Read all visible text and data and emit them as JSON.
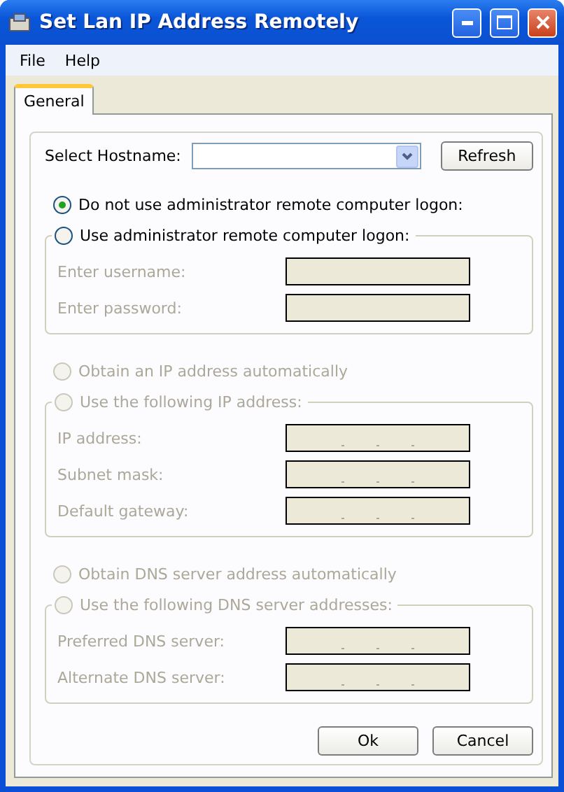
{
  "window": {
    "title": "Set Lan IP Address Remotely"
  },
  "menu": [
    {
      "label": "File"
    },
    {
      "label": "Help"
    }
  ],
  "tabs": [
    {
      "label": "General",
      "selected": true
    }
  ],
  "hostname": {
    "label": "Select Hostname:",
    "refresh": "Refresh"
  },
  "sections": [
    {
      "auto_option": {
        "label": "Do not use administrator remote computer logon:",
        "selected": true,
        "disabled": false
      },
      "manual_option": {
        "label": "Use administrator remote computer logon:",
        "selected": false,
        "disabled": false
      },
      "fields": [
        {
          "label": "Enter username:",
          "kind": "text",
          "disabled": true
        },
        {
          "label": "Enter password:",
          "kind": "text",
          "disabled": true
        }
      ]
    },
    {
      "auto_option": {
        "label": "Obtain an IP address automatically",
        "selected": false,
        "disabled": true
      },
      "manual_option": {
        "label": "Use the following IP address:",
        "selected": false,
        "disabled": true
      },
      "fields": [
        {
          "label": "IP address:",
          "kind": "ip",
          "disabled": true
        },
        {
          "label": "Subnet mask:",
          "kind": "ip",
          "disabled": true
        },
        {
          "label": "Default gateway:",
          "kind": "ip",
          "disabled": true
        }
      ]
    },
    {
      "auto_option": {
        "label": "Obtain DNS server address automatically",
        "selected": false,
        "disabled": true
      },
      "manual_option": {
        "label": "Use the following DNS server addresses:",
        "selected": false,
        "disabled": true
      },
      "fields": [
        {
          "label": "Preferred DNS server:",
          "kind": "ip",
          "disabled": true
        },
        {
          "label": "Alternate DNS server:",
          "kind": "ip",
          "disabled": true
        }
      ]
    }
  ],
  "buttons": [
    {
      "label": "Ok"
    },
    {
      "label": "Cancel"
    }
  ]
}
